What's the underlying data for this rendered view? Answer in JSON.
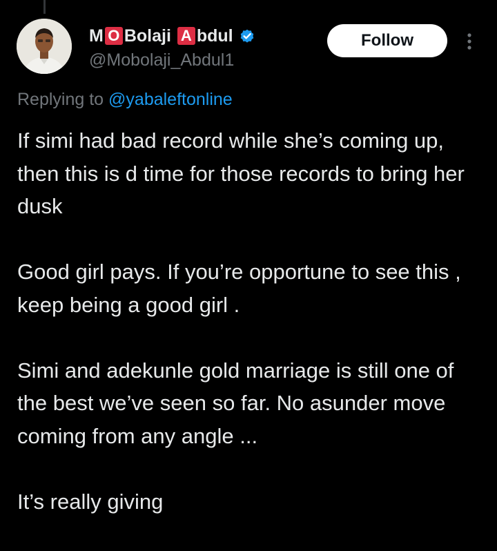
{
  "author": {
    "name_parts": [
      {
        "type": "text",
        "value": "M"
      },
      {
        "type": "emoji",
        "value": "O",
        "color": "#dd2e44"
      },
      {
        "type": "text",
        "value": "Bolaji "
      },
      {
        "type": "emoji",
        "value": "A",
        "color": "#dd2e44"
      },
      {
        "type": "text",
        "value": "bdul"
      }
    ],
    "handle": "@Mobolaji_Abdul1",
    "verified": true,
    "verified_color": "#1d9bf0"
  },
  "follow_button": {
    "label": "Follow"
  },
  "more_menu": {
    "icon": "more-vertical-icon"
  },
  "reply_context": {
    "prefix": "Replying to ",
    "mention": "@yabaleftonline"
  },
  "tweet": {
    "paragraphs": [
      "If simi had bad record while she’s coming up, then this is d time for those records to bring her dusk",
      "Good girl pays. If you’re opportune to see this , keep being a good girl .",
      "Simi and adekunle gold marriage is still one of the best we’ve seen so far. No asunder move coming from any angle ...",
      "It’s  really giving"
    ]
  },
  "colors": {
    "background": "#000000",
    "text_primary": "#e7e9ea",
    "text_secondary": "#71767b",
    "link": "#1d9bf0",
    "button_bg": "#ffffff",
    "button_text": "#0f1419"
  }
}
